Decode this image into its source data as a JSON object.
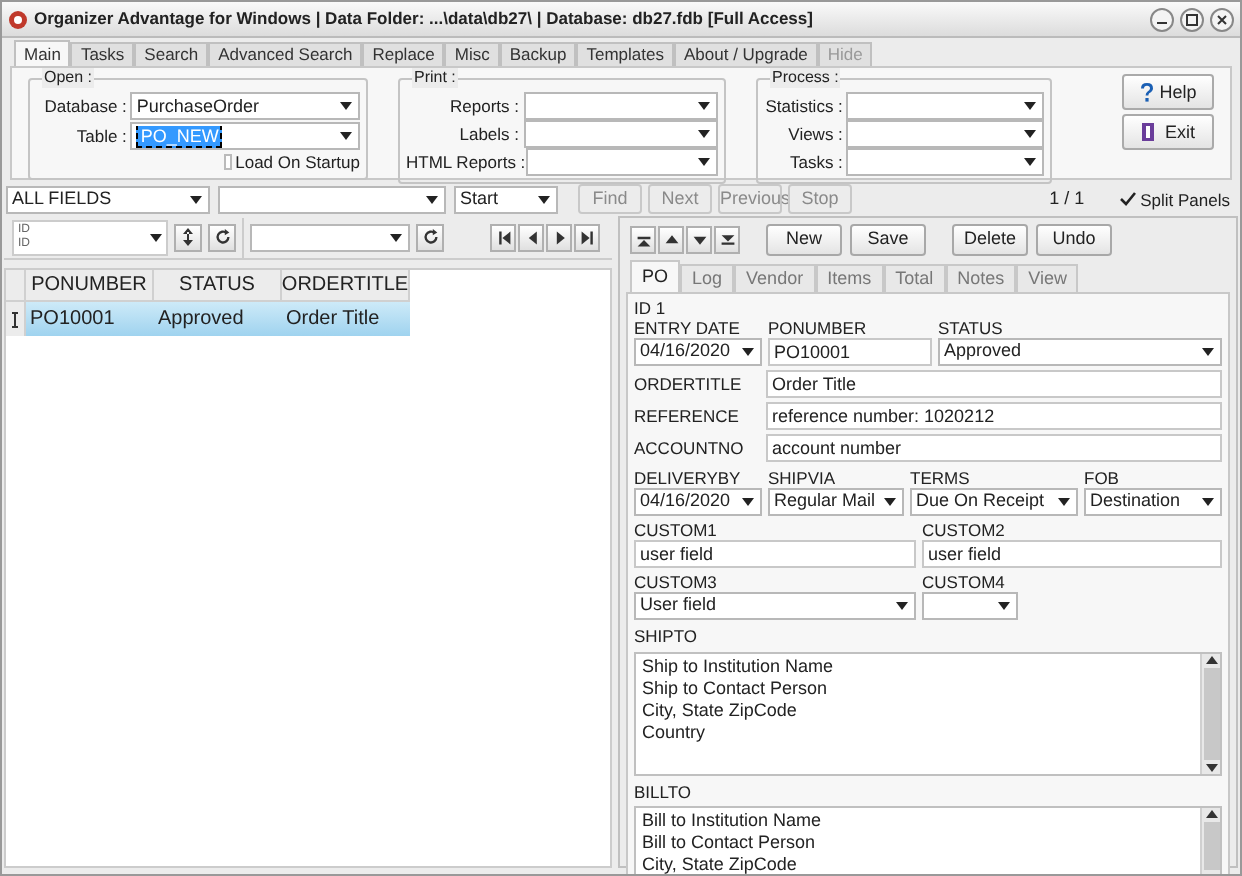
{
  "window": {
    "title": "Organizer Advantage for Windows | Data Folder: ...\\data\\db27\\ | Database: db27.fdb [Full Access]"
  },
  "tabs": [
    {
      "label": "Main",
      "selected": true,
      "disabled": false
    },
    {
      "label": "Tasks",
      "selected": false,
      "disabled": false
    },
    {
      "label": "Search",
      "selected": false,
      "disabled": false
    },
    {
      "label": "Advanced Search",
      "selected": false,
      "disabled": false
    },
    {
      "label": "Replace",
      "selected": false,
      "disabled": false
    },
    {
      "label": "Misc",
      "selected": false,
      "disabled": false
    },
    {
      "label": "Backup",
      "selected": false,
      "disabled": false
    },
    {
      "label": "Templates",
      "selected": false,
      "disabled": false
    },
    {
      "label": "About / Upgrade",
      "selected": false,
      "disabled": false
    },
    {
      "label": "Hide",
      "selected": false,
      "disabled": true
    }
  ],
  "open_group": {
    "title": "Open :",
    "fields": [
      {
        "label": "Database :",
        "value": "PurchaseOrder",
        "selected": false
      },
      {
        "label": "Table :",
        "value": "PO_NEW",
        "selected": true
      }
    ],
    "load_on_startup": {
      "label": "Load On Startup",
      "checked": false
    }
  },
  "print_group": {
    "title": "Print :",
    "fields": [
      {
        "label": "Reports :"
      },
      {
        "label": "Labels :"
      },
      {
        "label": "HTML Reports :"
      }
    ]
  },
  "process_group": {
    "title": "Process :",
    "fields": [
      {
        "label": "Statistics :"
      },
      {
        "label": "Views :"
      },
      {
        "label": "Tasks :"
      }
    ]
  },
  "side_buttons": [
    {
      "kind": "help",
      "label": "Help"
    },
    {
      "kind": "exit",
      "label": "Exit"
    }
  ],
  "search_bar": {
    "field": "ALL FIELDS",
    "start": "Start",
    "buttons": [
      {
        "label": "Find",
        "disabled": true
      },
      {
        "label": "Next",
        "disabled": true
      },
      {
        "label": "Previous",
        "disabled": true
      },
      {
        "label": "Stop",
        "disabled": true
      }
    ],
    "count": "1 / 1",
    "split_panels": {
      "label": "Split Panels",
      "checked": true
    }
  },
  "grid": {
    "sort_field": {
      "value": "ID",
      "caption": "ID"
    },
    "columns": [
      "PONUMBER",
      "STATUS",
      "ORDERTITLE"
    ],
    "rows": [
      {
        "cells": [
          "PO10001",
          "Approved",
          "Order Title"
        ],
        "selected": true
      }
    ]
  },
  "record_buttons": [
    "New",
    "Save",
    "Delete",
    "Undo"
  ],
  "record_tabs": [
    {
      "label": "PO",
      "selected": true
    },
    {
      "label": "Log",
      "selected": false
    },
    {
      "label": "Vendor",
      "selected": false
    },
    {
      "label": "Items",
      "selected": false
    },
    {
      "label": "Total",
      "selected": false
    },
    {
      "label": "Notes",
      "selected": false
    },
    {
      "label": "View",
      "selected": false
    }
  ],
  "record": {
    "id_label": "ID 1",
    "entry_date": {
      "label": "ENTRY DATE",
      "value": "04/16/2020"
    },
    "ponumber": {
      "label": "PONUMBER",
      "value": "PO10001"
    },
    "status": {
      "label": "STATUS",
      "value": "Approved"
    },
    "ordertitle": {
      "label": "ORDERTITLE",
      "value": "Order Title"
    },
    "reference": {
      "label": "REFERENCE",
      "value": "reference number: 1020212"
    },
    "accountno": {
      "label": "ACCOUNTNO",
      "value": "account number"
    },
    "deliveryby": {
      "label": "DELIVERYBY",
      "value": "04/16/2020"
    },
    "shipvia": {
      "label": "SHIPVIA",
      "value": "Regular Mail"
    },
    "terms": {
      "label": "TERMS",
      "value": "Due On Receipt"
    },
    "fob": {
      "label": "FOB",
      "value": "Destination"
    },
    "custom1": {
      "label": "CUSTOM1",
      "value": "user field"
    },
    "custom2": {
      "label": "CUSTOM2",
      "value": "user field"
    },
    "custom3": {
      "label": "CUSTOM3",
      "value": "User field"
    },
    "custom4": {
      "label": "CUSTOM4"
    },
    "shipto": {
      "label": "SHIPTO",
      "lines": [
        "Ship to Institution Name",
        "Ship to Contact Person",
        "City, State  ZipCode",
        "Country"
      ]
    },
    "billto": {
      "label": "BILLTO",
      "lines": [
        "Bill to Institution Name",
        "Bill to Contact Person",
        "City, State  ZipCode"
      ]
    }
  }
}
